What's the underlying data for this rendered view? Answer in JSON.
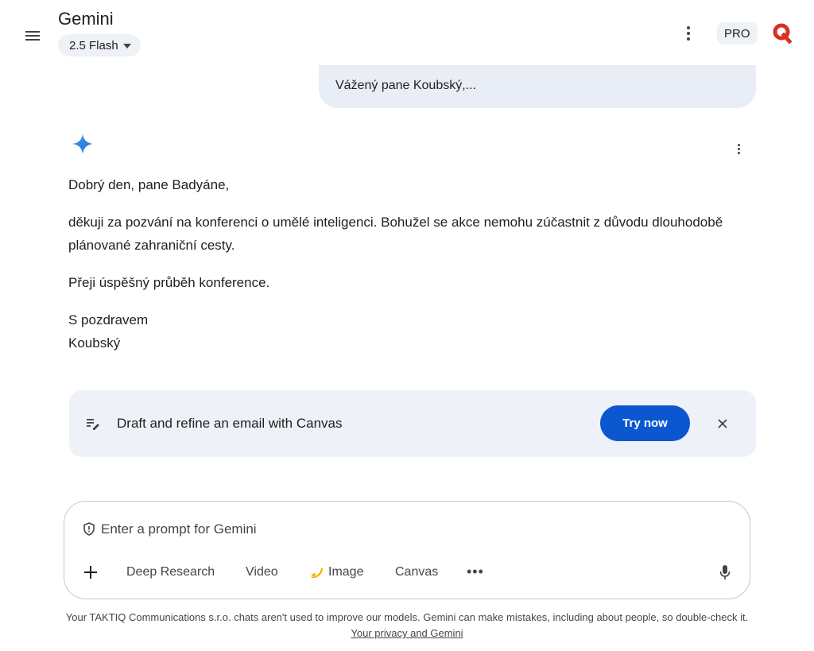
{
  "header": {
    "title": "Gemini",
    "model_label": "2.5 Flash",
    "pro_label": "PRO",
    "icons": [
      "menu-icon",
      "chevron-down-icon",
      "more-vert-icon",
      "avatar-logo"
    ]
  },
  "conversation": {
    "user_message_partial": "Vážený pane Koubský,..."
  },
  "response": {
    "greeting": "Dobrý den, pane Badyáne,",
    "body": "děkuji za pozvání na konferenci o umělé inteligenci. Bohužel se akce nemohu zúčastnit z důvodu dlouhodobě plánované zahraniční cesty.",
    "wish": "Přeji úspěšný průběh konference.",
    "closing": "S pozdravem",
    "signature": "Koubský"
  },
  "promo": {
    "text": "Draft and refine an email with Canvas",
    "button_label": "Try now"
  },
  "prompt": {
    "placeholder": "Enter a prompt for Gemini",
    "tools": {
      "deep_research": "Deep Research",
      "video": "Video",
      "image": "Image",
      "canvas": "Canvas",
      "more": "•••"
    }
  },
  "footer": {
    "disclaimer": "Your TAKTIQ Communications s.r.o. chats aren't used to improve our models. Gemini can make mistakes, including about people, so double-check it.",
    "privacy_link": "Your privacy and Gemini"
  },
  "colors": {
    "accent": "#0b57d0",
    "bubble": "#e9eef6",
    "promo_bg": "#eef2f8",
    "avatar_red": "#d93025"
  }
}
